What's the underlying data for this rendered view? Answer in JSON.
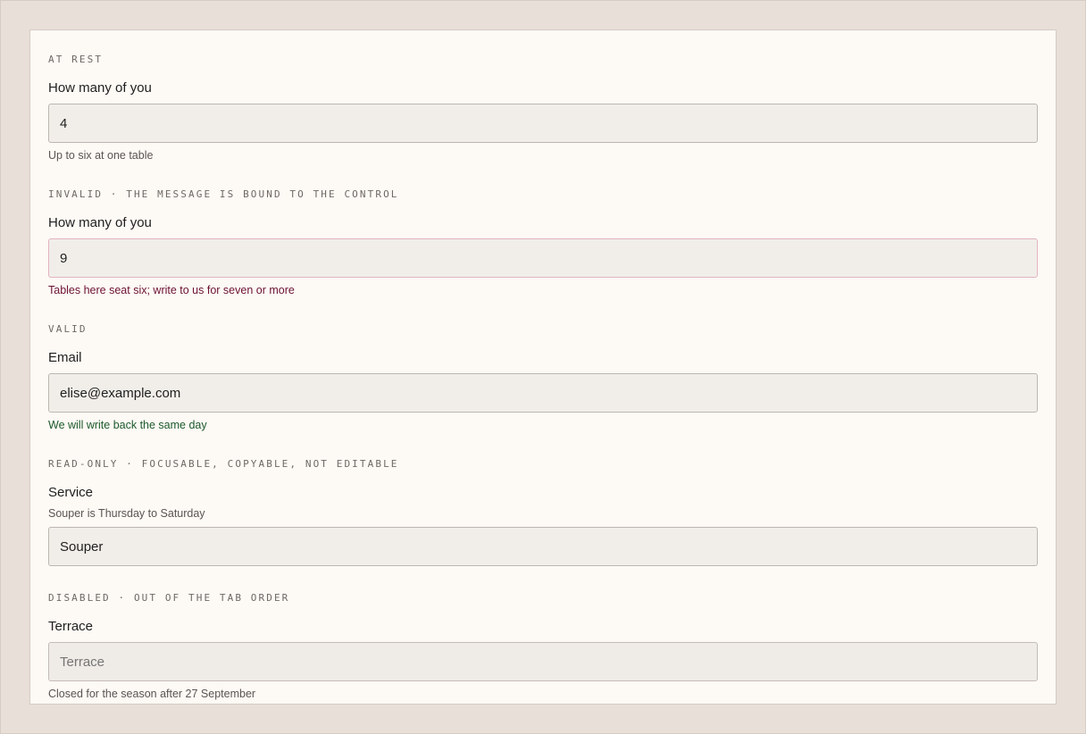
{
  "states": [
    {
      "kicker": "AT REST",
      "label": "How many of you",
      "value": "4",
      "help": "Up to six at one table"
    },
    {
      "kicker": "INVALID · THE MESSAGE IS BOUND TO THE CONTROL",
      "label": "How many of you",
      "value": "9",
      "help": "Tables here seat six; write to us for seven or more"
    },
    {
      "kicker": "VALID",
      "label": "Email",
      "value": "elise@example.com",
      "help": "We will write back the same day"
    },
    {
      "kicker": "READ-ONLY · FOCUSABLE, COPYABLE, NOT EDITABLE",
      "label": "Service",
      "description": "Souper is Thursday to Saturday",
      "value": "Souper"
    },
    {
      "kicker": "DISABLED · OUT OF THE TAB ORDER",
      "label": "Terrace",
      "placeholder": "Terrace",
      "help": "Closed for the season after 27 September"
    }
  ],
  "colors": {
    "page_bg": "#e8dfd9",
    "panel_bg": "#fdf9f5",
    "field_bg": "#f1eee9",
    "field_border": "#bdb6b0",
    "invalid_border": "#e2b3c2",
    "error_text": "#6d1234",
    "success_text": "#1b5a2b"
  }
}
